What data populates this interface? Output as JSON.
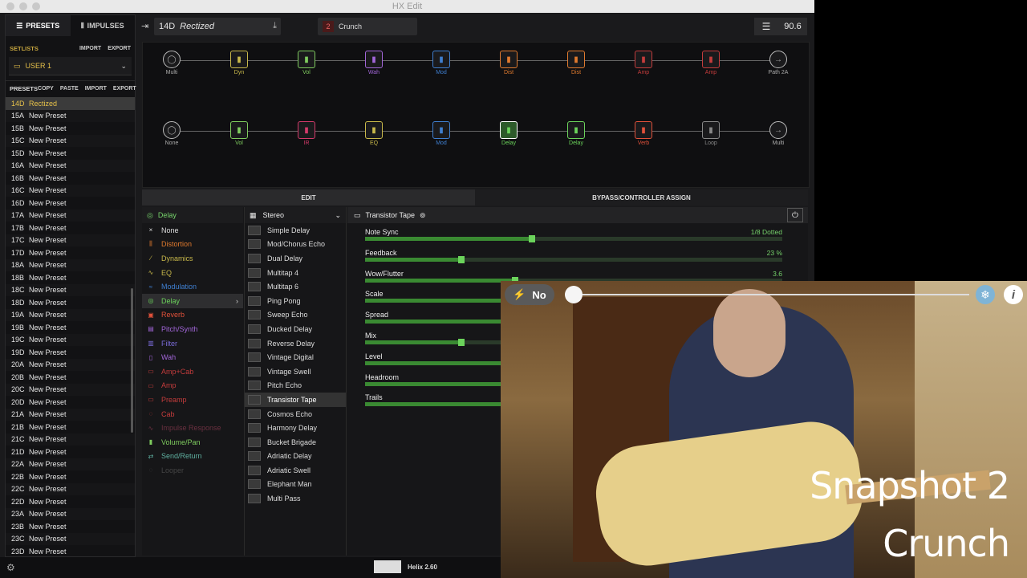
{
  "window": {
    "title": "HX Edit"
  },
  "sidebar": {
    "tabs": [
      "PRESETS",
      "IMPULSES"
    ],
    "setlists_label": "SETLISTS",
    "setlists_actions": [
      "IMPORT",
      "EXPORT"
    ],
    "setlist_selected": "USER 1",
    "presets_label": "PRESETS",
    "presets_actions": [
      "COPY",
      "PASTE",
      "IMPORT",
      "EXPORT"
    ],
    "presets": [
      {
        "num": "14D",
        "name": "Rectized"
      },
      {
        "num": "15A",
        "name": "New Preset"
      },
      {
        "num": "15B",
        "name": "New Preset"
      },
      {
        "num": "15C",
        "name": "New Preset"
      },
      {
        "num": "15D",
        "name": "New Preset"
      },
      {
        "num": "16A",
        "name": "New Preset"
      },
      {
        "num": "16B",
        "name": "New Preset"
      },
      {
        "num": "16C",
        "name": "New Preset"
      },
      {
        "num": "16D",
        "name": "New Preset"
      },
      {
        "num": "17A",
        "name": "New Preset"
      },
      {
        "num": "17B",
        "name": "New Preset"
      },
      {
        "num": "17C",
        "name": "New Preset"
      },
      {
        "num": "17D",
        "name": "New Preset"
      },
      {
        "num": "18A",
        "name": "New Preset"
      },
      {
        "num": "18B",
        "name": "New Preset"
      },
      {
        "num": "18C",
        "name": "New Preset"
      },
      {
        "num": "18D",
        "name": "New Preset"
      },
      {
        "num": "19A",
        "name": "New Preset"
      },
      {
        "num": "19B",
        "name": "New Preset"
      },
      {
        "num": "19C",
        "name": "New Preset"
      },
      {
        "num": "19D",
        "name": "New Preset"
      },
      {
        "num": "20A",
        "name": "New Preset"
      },
      {
        "num": "20B",
        "name": "New Preset"
      },
      {
        "num": "20C",
        "name": "New Preset"
      },
      {
        "num": "20D",
        "name": "New Preset"
      },
      {
        "num": "21A",
        "name": "New Preset"
      },
      {
        "num": "21B",
        "name": "New Preset"
      },
      {
        "num": "21C",
        "name": "New Preset"
      },
      {
        "num": "21D",
        "name": "New Preset"
      },
      {
        "num": "22A",
        "name": "New Preset"
      },
      {
        "num": "22B",
        "name": "New Preset"
      },
      {
        "num": "22C",
        "name": "New Preset"
      },
      {
        "num": "22D",
        "name": "New Preset"
      },
      {
        "num": "23A",
        "name": "New Preset"
      },
      {
        "num": "23B",
        "name": "New Preset"
      },
      {
        "num": "23C",
        "name": "New Preset"
      },
      {
        "num": "23D",
        "name": "New Preset"
      }
    ]
  },
  "topbar": {
    "preset_num": "14D",
    "preset_name": "Rectized",
    "snapshot_num": "2",
    "snapshot_name": "Crunch",
    "tempo": "90.6"
  },
  "flow": {
    "path1": [
      {
        "label": "Multi",
        "color": "#aaaaaa",
        "icon": "input-icon"
      },
      {
        "label": "Dyn",
        "color": "#c8b84a",
        "icon": "dyn-icon"
      },
      {
        "label": "Vol",
        "color": "#7ecb5e",
        "icon": "vol-icon"
      },
      {
        "label": "Wah",
        "color": "#a266d9",
        "icon": "wah-icon"
      },
      {
        "label": "Mod",
        "color": "#3f7fd0",
        "icon": "mod-icon"
      },
      {
        "label": "Dist",
        "color": "#e07a2e",
        "icon": "dist-icon"
      },
      {
        "label": "Dist",
        "color": "#e07a2e",
        "icon": "dist-icon"
      },
      {
        "label": "Amp",
        "color": "#c43c3c",
        "icon": "amp-icon"
      },
      {
        "label": "Amp",
        "color": "#c43c3c",
        "icon": "amp-icon"
      },
      {
        "label": "Path 2A",
        "color": "#aaaaaa",
        "icon": "split-icon"
      }
    ],
    "path2": [
      {
        "label": "None",
        "color": "#aaaaaa",
        "icon": "none-icon"
      },
      {
        "label": "Vol",
        "color": "#7ecb5e",
        "icon": "vol-icon"
      },
      {
        "label": "IR",
        "color": "#d23a6a",
        "icon": "ir-icon"
      },
      {
        "label": "EQ",
        "color": "#c8b84a",
        "icon": "eq-icon"
      },
      {
        "label": "Mod",
        "color": "#3f7fd0",
        "icon": "mod-icon"
      },
      {
        "label": "Delay",
        "color": "#6bd35b",
        "icon": "delay-icon"
      },
      {
        "label": "Delay",
        "color": "#6bd35b",
        "icon": "delay-icon"
      },
      {
        "label": "Verb",
        "color": "#e0513a",
        "icon": "verb-icon"
      },
      {
        "label": "Loop",
        "color": "#888888",
        "icon": "loop-icon"
      },
      {
        "label": "Multi",
        "color": "#aaaaaa",
        "icon": "output-icon"
      }
    ]
  },
  "edit_tabs": [
    "EDIT",
    "BYPASS/CONTROLLER ASSIGN"
  ],
  "categories": {
    "selected": "Delay",
    "items": [
      {
        "label": "None",
        "color": "#dddddd",
        "icon": "×"
      },
      {
        "label": "Distortion",
        "color": "#e07a2e",
        "icon": "⫼"
      },
      {
        "label": "Dynamics",
        "color": "#c8b84a",
        "icon": "∕"
      },
      {
        "label": "EQ",
        "color": "#c8b84a",
        "icon": "∿"
      },
      {
        "label": "Modulation",
        "color": "#3f7fd0",
        "icon": "≈"
      },
      {
        "label": "Delay",
        "color": "#6bd35b",
        "icon": "◎"
      },
      {
        "label": "Reverb",
        "color": "#e0513a",
        "icon": "▣"
      },
      {
        "label": "Pitch/Synth",
        "color": "#a266d9",
        "icon": "▤"
      },
      {
        "label": "Filter",
        "color": "#7a6bd9",
        "icon": "▥"
      },
      {
        "label": "Wah",
        "color": "#a266d9",
        "icon": "▯"
      },
      {
        "label": "Amp+Cab",
        "color": "#c43c3c",
        "icon": "▭"
      },
      {
        "label": "Amp",
        "color": "#c43c3c",
        "icon": "▭"
      },
      {
        "label": "Preamp",
        "color": "#c43c3c",
        "icon": "▭"
      },
      {
        "label": "Cab",
        "color": "#c43c3c",
        "icon": "◌"
      },
      {
        "label": "Impulse Response",
        "color": "#6a3040",
        "icon": "∿"
      },
      {
        "label": "Volume/Pan",
        "color": "#7ecb5e",
        "icon": "▮"
      },
      {
        "label": "Send/Return",
        "color": "#5fb0a0",
        "icon": "⇄"
      },
      {
        "label": "Looper",
        "color": "#444444",
        "icon": "◌"
      }
    ]
  },
  "models": {
    "header": "Stereo",
    "selected": "Transistor Tape",
    "items": [
      "Simple Delay",
      "Mod/Chorus Echo",
      "Dual Delay",
      "Multitap 4",
      "Multitap 6",
      "Ping Pong",
      "Sweep Echo",
      "Ducked Delay",
      "Reverse Delay",
      "Vintage Digital",
      "Vintage Swell",
      "Pitch Echo",
      "Transistor Tape",
      "Cosmos Echo",
      "Harmony Delay",
      "Bucket Brigade",
      "Adriatic Delay",
      "Adriatic Swell",
      "Elephant Man",
      "Multi Pass"
    ]
  },
  "params": {
    "model_name": "Transistor Tape",
    "items": [
      {
        "label": "Note Sync",
        "value": "1/8 Dotted",
        "level": 0.4
      },
      {
        "label": "Feedback",
        "value": "23 %",
        "level": 0.23
      },
      {
        "label": "Wow/Flutter",
        "value": "3.6",
        "level": 0.36
      },
      {
        "label": "Scale",
        "value": "",
        "level": 0.5
      },
      {
        "label": "Spread",
        "value": "",
        "level": 0.5
      },
      {
        "label": "Mix",
        "value": "",
        "level": 0.23
      },
      {
        "label": "Level",
        "value": "",
        "level": 0.5
      },
      {
        "label": "Headroom",
        "value": "",
        "level": 0.5
      },
      {
        "label": "Trails",
        "value": "",
        "level": 0.5
      }
    ]
  },
  "footer": {
    "device": "Helix 2.60"
  },
  "video": {
    "toggle_label": "No",
    "caption_line1": "Snapshot 2",
    "caption_line2": "Crunch"
  }
}
